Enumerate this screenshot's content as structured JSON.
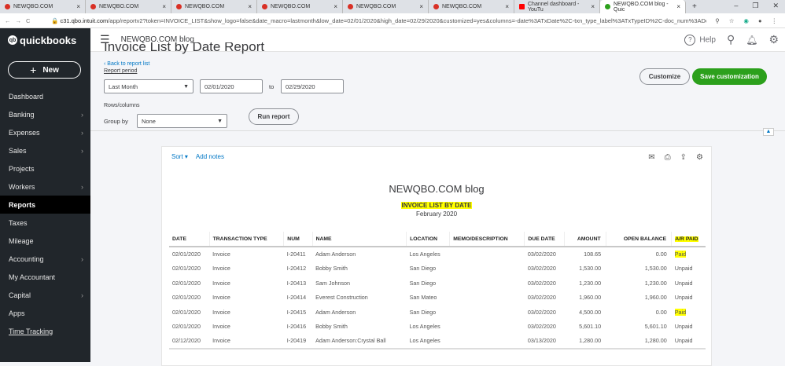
{
  "browser": {
    "tabs": [
      {
        "title": "NEWQBO.COM",
        "icon": "quickbooks-favicon"
      },
      {
        "title": "NEWQBO.COM",
        "icon": "quickbooks-favicon"
      },
      {
        "title": "NEWQBO.COM",
        "icon": "quickbooks-favicon"
      },
      {
        "title": "NEWQBO.COM",
        "icon": "quickbooks-favicon"
      },
      {
        "title": "NEWQBO.COM",
        "icon": "quickbooks-favicon"
      },
      {
        "title": "NEWQBO.COM",
        "icon": "quickbooks-favicon"
      },
      {
        "title": "Channel dashboard - YouTu",
        "icon": "youtube-favicon"
      },
      {
        "title": "NEWQBO.COM blog - Quic",
        "icon": "quickbooks-favicon",
        "active": true
      }
    ],
    "url_host": "c31.qbo.intuit.com",
    "url_path": "/app/reportv2?token=INVOICE_LIST&show_logo=false&date_macro=lastmonth&low_date=02/01/2020&high_date=02/29/2020&customized=yes&columns=-date%3ATxDate%2C-txn_type_label%3ATxTypeID%2C-doc_num%3ADocNu..."
  },
  "sidebar": {
    "logo": "quickbooks",
    "logo_small": "intuit",
    "new_label": "New",
    "items": [
      {
        "label": "Dashboard",
        "chevron": false
      },
      {
        "label": "Banking",
        "chevron": true
      },
      {
        "label": "Expenses",
        "chevron": true
      },
      {
        "label": "Sales",
        "chevron": true
      },
      {
        "label": "Projects",
        "chevron": false
      },
      {
        "label": "Workers",
        "chevron": true
      },
      {
        "label": "Reports",
        "chevron": false,
        "active": true
      },
      {
        "label": "Taxes",
        "chevron": false
      },
      {
        "label": "Mileage",
        "chevron": false
      },
      {
        "label": "Accounting",
        "chevron": true
      },
      {
        "label": "My Accountant",
        "chevron": false
      },
      {
        "label": "Capital",
        "chevron": true
      },
      {
        "label": "Apps",
        "chevron": false
      },
      {
        "label": "Time Tracking",
        "chevron": false
      }
    ]
  },
  "header": {
    "company": "NEWQBO.COM blog",
    "help": "Help"
  },
  "page": {
    "title": "Invoice List by Date Report",
    "back_link": "Back to report list",
    "report_period_label": "Report period",
    "period": "Last Month",
    "from": "02/01/2020",
    "to_label": "to",
    "to": "02/29/2020",
    "rows_columns_label": "Rows/columns",
    "group_by_label": "Group by",
    "group_by": "None",
    "run_report": "Run report",
    "customize": "Customize",
    "save_customization": "Save customization"
  },
  "report": {
    "sort": "Sort",
    "add_notes": "Add notes",
    "company": "NEWQBO.COM blog",
    "title": "INVOICE LIST BY DATE",
    "period": "February 2020",
    "columns": [
      "DATE",
      "TRANSACTION TYPE",
      "NUM",
      "NAME",
      "LOCATION",
      "MEMO/DESCRIPTION",
      "DUE DATE",
      "AMOUNT",
      "OPEN BALANCE",
      "A/R PAID"
    ],
    "rows": [
      [
        "02/01/2020",
        "Invoice",
        "I-20411",
        "Adam Anderson",
        "Los Angeles",
        "",
        "03/02/2020",
        "108.65",
        "0.00",
        "Paid"
      ],
      [
        "02/01/2020",
        "Invoice",
        "I-20412",
        "Bobby Smith",
        "San Diego",
        "",
        "03/02/2020",
        "1,530.00",
        "1,530.00",
        "Unpaid"
      ],
      [
        "02/01/2020",
        "Invoice",
        "I-20413",
        "Sam Johnson",
        "San Diego",
        "",
        "03/02/2020",
        "1,230.00",
        "1,230.00",
        "Unpaid"
      ],
      [
        "02/01/2020",
        "Invoice",
        "I-20414",
        "Everest Construction",
        "San Mateo",
        "",
        "03/02/2020",
        "1,960.00",
        "1,960.00",
        "Unpaid"
      ],
      [
        "02/01/2020",
        "Invoice",
        "I-20415",
        "Adam Anderson",
        "San Diego",
        "",
        "03/02/2020",
        "4,500.00",
        "0.00",
        "Paid"
      ],
      [
        "02/01/2020",
        "Invoice",
        "I-20416",
        "Bobby Smith",
        "Los Angeles",
        "",
        "03/02/2020",
        "5,601.10",
        "5,601.10",
        "Unpaid"
      ],
      [
        "02/12/2020",
        "Invoice",
        "I-20419",
        "Adam Anderson:Crystal Ball",
        "Los Angeles",
        "",
        "03/13/2020",
        "1,280.00",
        "1,280.00",
        "Unpaid"
      ]
    ]
  }
}
